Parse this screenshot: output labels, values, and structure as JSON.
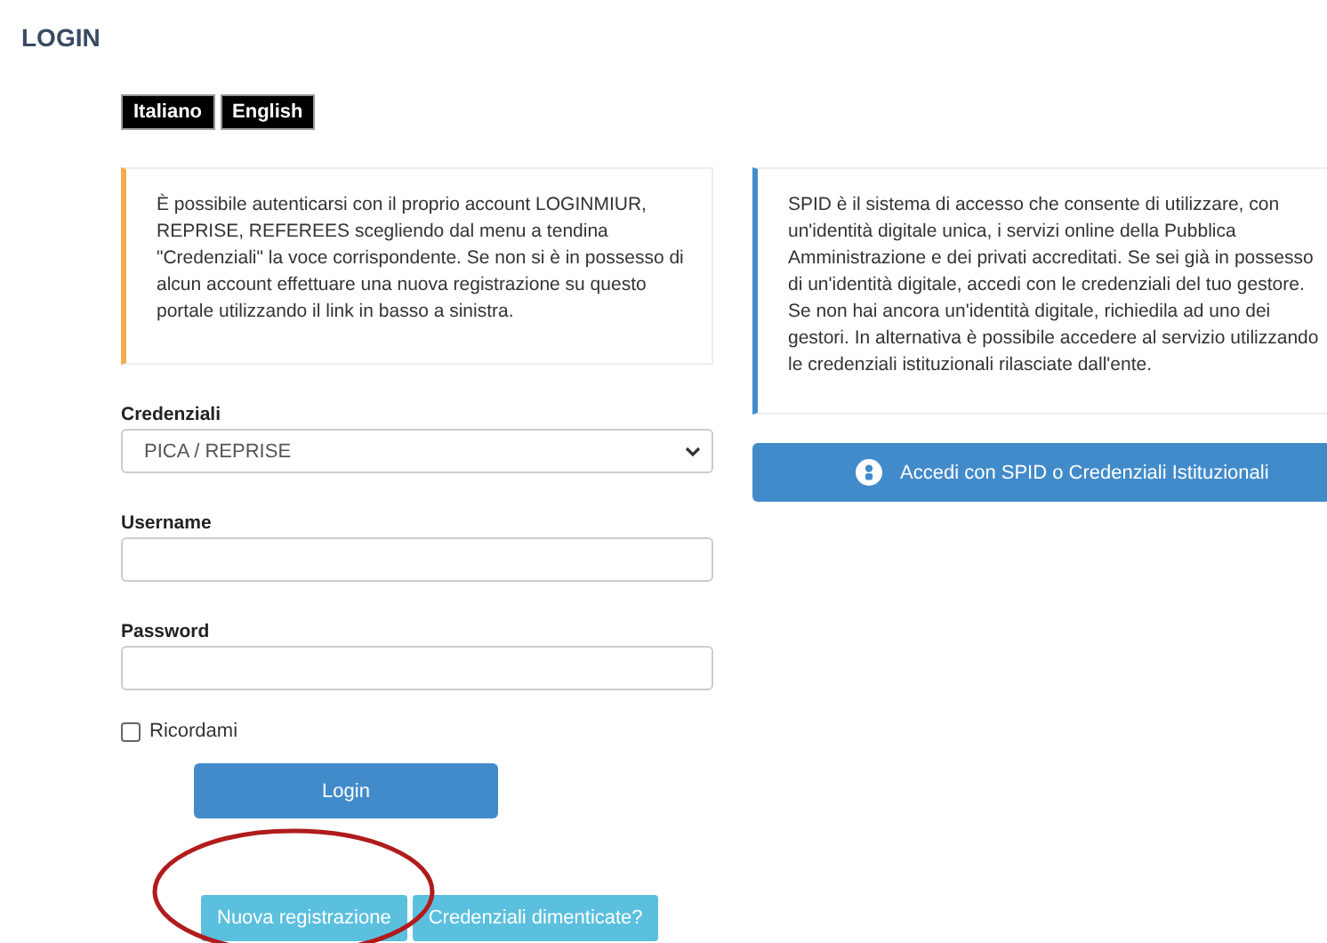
{
  "page_title": "LOGIN",
  "languages": [
    {
      "label": "Italiano"
    },
    {
      "label": "English"
    }
  ],
  "info_left": "È possibile autenticarsi con il proprio account LOGINMIUR, REPRISE, REFEREES scegliendo dal menu a tendina \"Credenziali\" la voce corrispondente. Se non si è in possesso di alcun account effettuare una nuova registrazione su questo portale utilizzando il link in basso a sinistra.",
  "form": {
    "credentials_label": "Credenziali",
    "credentials_value": "PICA / REPRISE",
    "username_label": "Username",
    "password_label": "Password",
    "remember": {
      "label": "Ricordami",
      "checked": false
    },
    "login_button": "Login"
  },
  "links": [
    "Nuova registrazione",
    "Credenziali dimenticate?"
  ],
  "info_right": "SPID è il sistema di accesso che consente di utilizzare, con un'identità digitale unica, i servizi online della Pubblica Amministrazione e dei privati accreditati. Se sei già in possesso di un'identità digitale, accedi con le credenziali del tuo gestore. Se non hai ancora un'identità digitale, richiedila ad uno dei gestori. In alternativa è possibile accedere al servizio utilizzando le credenziali istituzionali rilasciate dall'ente.",
  "spid_button": "Accedi con SPID o Credenziali Istituzionali"
}
